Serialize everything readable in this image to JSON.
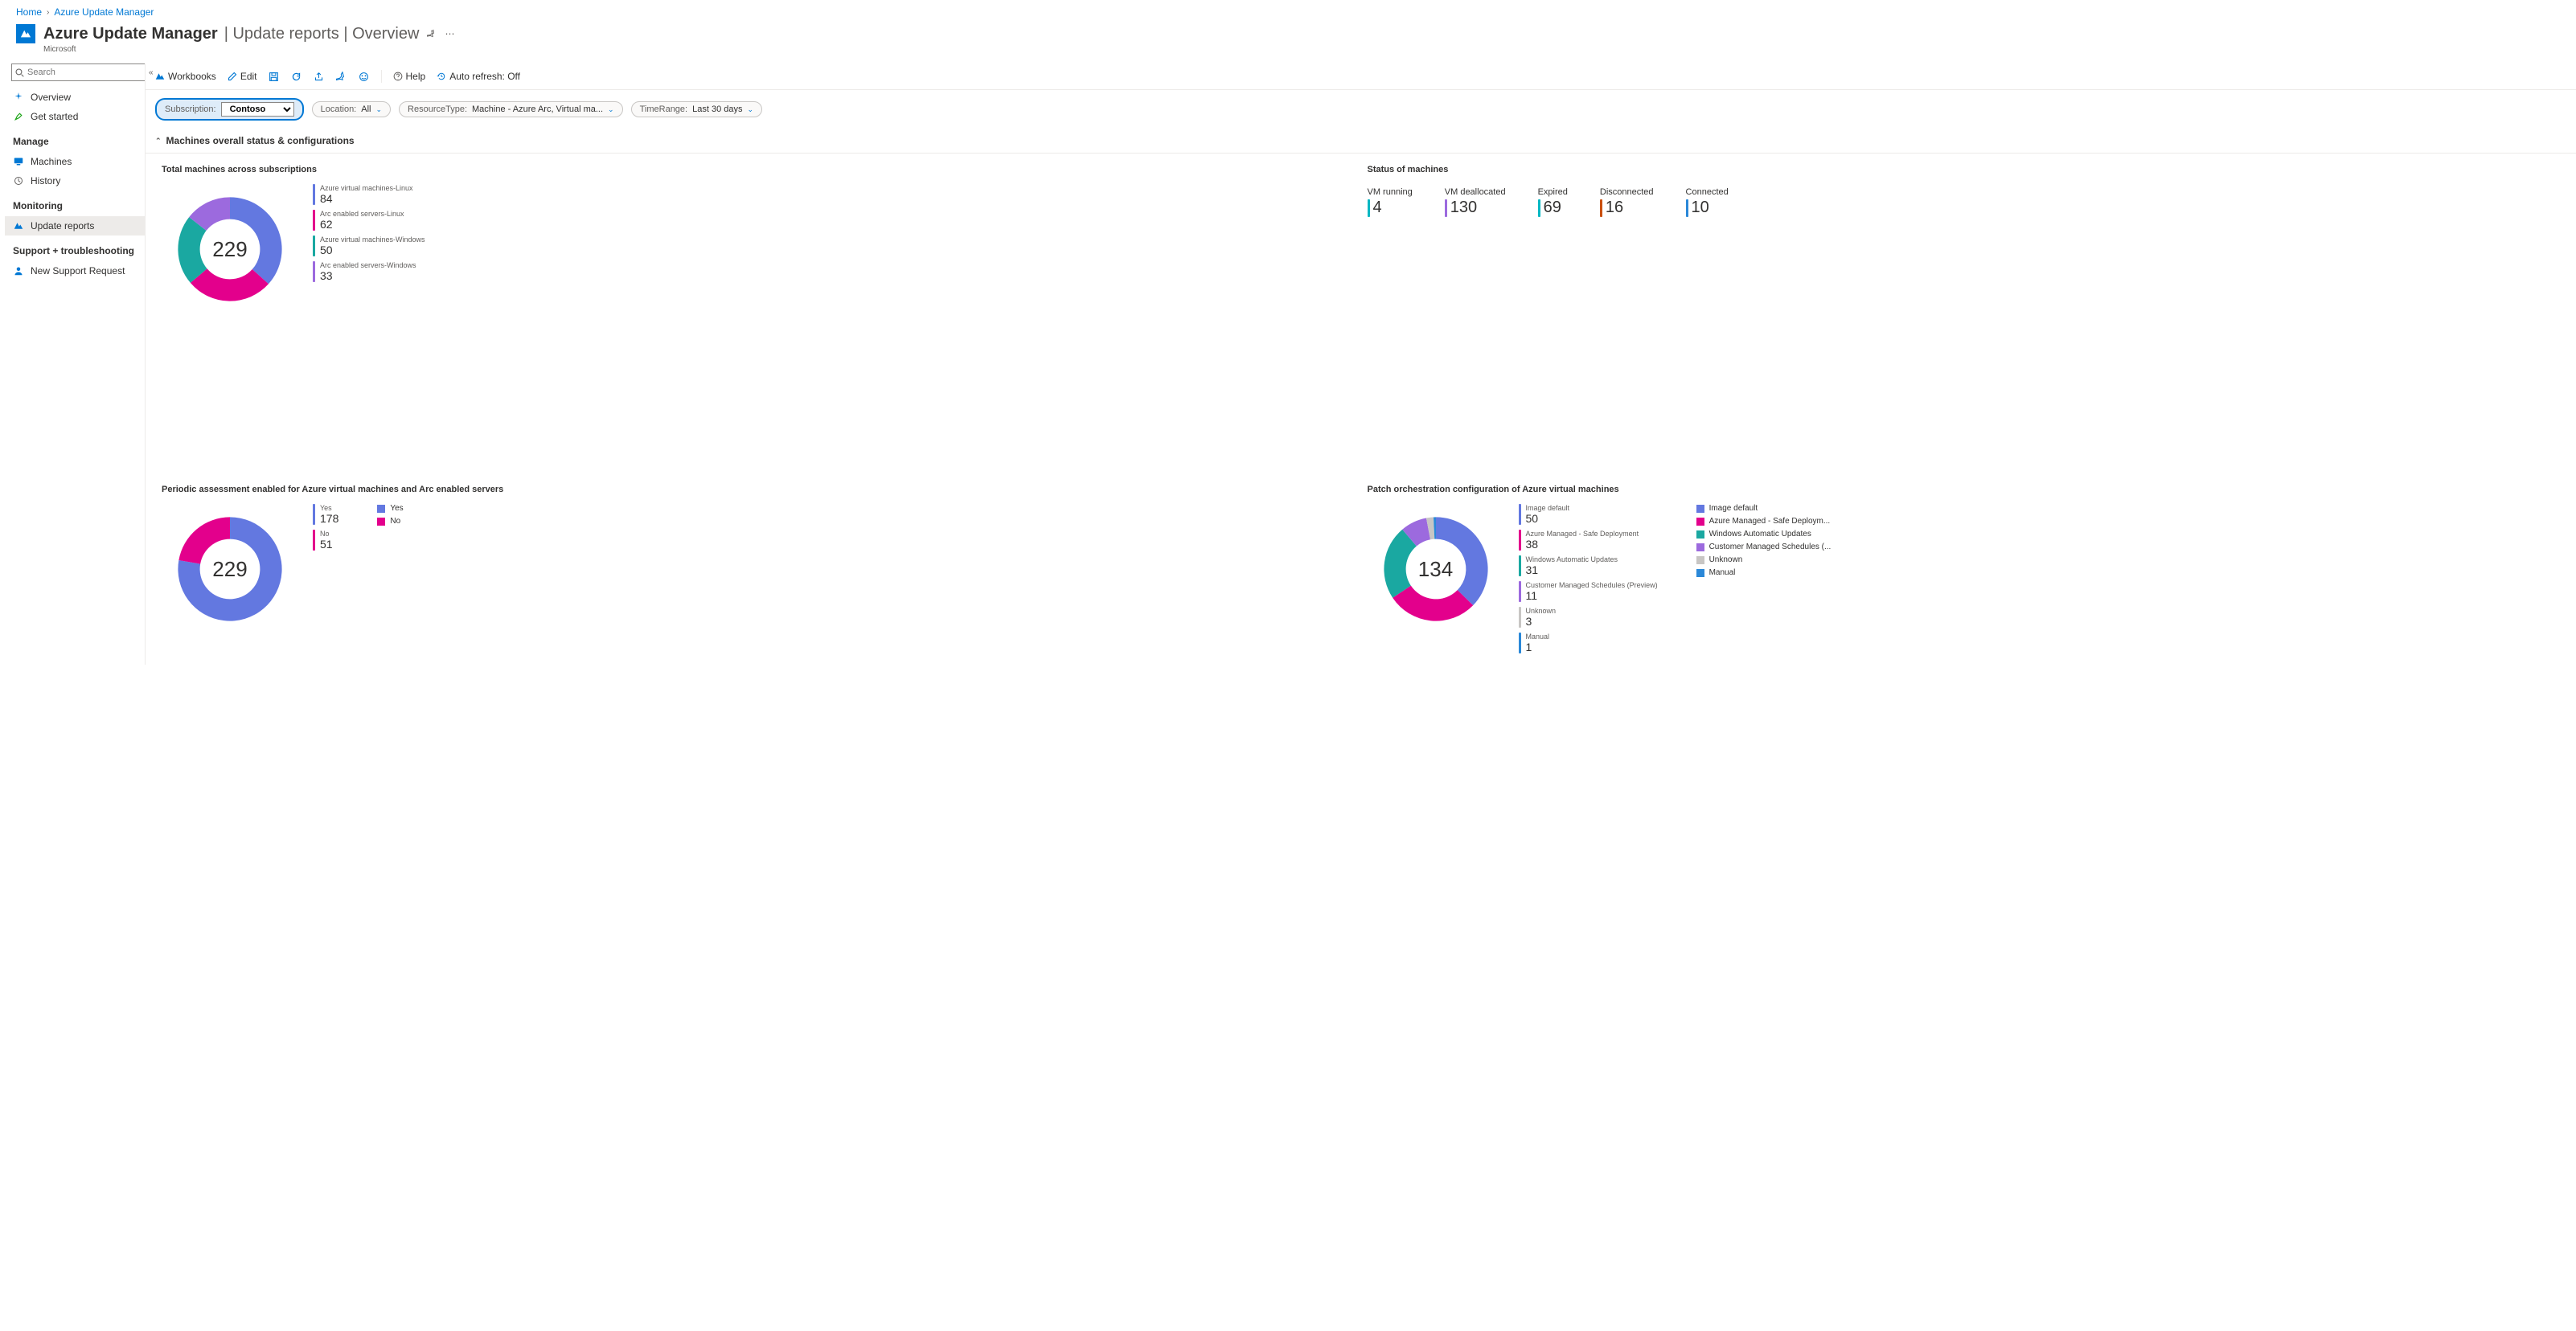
{
  "breadcrumb": {
    "home": "Home",
    "current": "Azure Update Manager"
  },
  "header": {
    "title": "Azure Update Manager",
    "subtitle": "| Update reports | Overview",
    "vendor": "Microsoft"
  },
  "search": {
    "placeholder": "Search"
  },
  "nav": {
    "items_top": [
      {
        "label": "Overview"
      },
      {
        "label": "Get started"
      }
    ],
    "manage_heading": "Manage",
    "items_manage": [
      {
        "label": "Machines"
      },
      {
        "label": "History"
      }
    ],
    "monitoring_heading": "Monitoring",
    "items_monitoring": [
      {
        "label": "Update reports"
      }
    ],
    "support_heading": "Support + troubleshooting",
    "items_support": [
      {
        "label": "New Support Request"
      }
    ]
  },
  "toolbar": {
    "workbooks": "Workbooks",
    "edit": "Edit",
    "help": "Help",
    "autorefresh": "Auto refresh: Off"
  },
  "filters": {
    "subscription_label": "Subscription:",
    "subscription_value": "Contoso",
    "location_label": "Location:",
    "location_value": "All",
    "resourcetype_label": "ResourceType:",
    "resourcetype_value": "Machine - Azure Arc, Virtual ma...",
    "timerange_label": "TimeRange:",
    "timerange_value": "Last 30 days"
  },
  "section_title": "Machines overall status & configurations",
  "cards": {
    "total_machines": {
      "title": "Total machines across subscriptions",
      "center": "229",
      "items": [
        {
          "label": "Azure virtual machines-Linux",
          "value": "84",
          "color": "c-blue"
        },
        {
          "label": "Arc enabled servers-Linux",
          "value": "62",
          "color": "c-magenta"
        },
        {
          "label": "Azure virtual machines-Windows",
          "value": "50",
          "color": "c-teal"
        },
        {
          "label": "Arc enabled servers-Windows",
          "value": "33",
          "color": "c-purple"
        }
      ]
    },
    "status": {
      "title": "Status of machines",
      "tiles": [
        {
          "label": "VM running",
          "value": "4",
          "color": "c-cyan"
        },
        {
          "label": "VM deallocated",
          "value": "130",
          "color": "c-purple"
        },
        {
          "label": "Expired",
          "value": "69",
          "color": "c-cyan"
        },
        {
          "label": "Disconnected",
          "value": "16",
          "color": "c-orange"
        },
        {
          "label": "Connected",
          "value": "10",
          "color": "c-dblue"
        }
      ]
    },
    "periodic": {
      "title": "Periodic assessment enabled for Azure virtual machines and Arc enabled servers",
      "center": "229",
      "items": [
        {
          "label": "Yes",
          "value": "178",
          "color": "c-blue"
        },
        {
          "label": "No",
          "value": "51",
          "color": "c-magenta"
        }
      ],
      "legend": [
        {
          "label": "Yes",
          "color": "c-blue"
        },
        {
          "label": "No",
          "color": "c-magenta"
        }
      ]
    },
    "patch": {
      "title": "Patch orchestration configuration of Azure virtual machines",
      "center": "134",
      "items": [
        {
          "label": "Image default",
          "value": "50",
          "color": "c-blue"
        },
        {
          "label": "Azure Managed - Safe Deployment",
          "value": "38",
          "color": "c-magenta"
        },
        {
          "label": "Windows Automatic Updates",
          "value": "31",
          "color": "c-teal"
        },
        {
          "label": "Customer Managed Schedules (Preview)",
          "value": "11",
          "color": "c-purple"
        },
        {
          "label": "Unknown",
          "value": "3",
          "color": "c-grey"
        },
        {
          "label": "Manual",
          "value": "1",
          "color": "c-dblue"
        }
      ],
      "legend": [
        {
          "label": "Image default",
          "color": "c-blue"
        },
        {
          "label": "Azure Managed - Safe Deploym...",
          "color": "c-magenta"
        },
        {
          "label": "Windows Automatic Updates",
          "color": "c-teal"
        },
        {
          "label": "Customer Managed Schedules (...",
          "color": "c-purple"
        },
        {
          "label": "Unknown",
          "color": "c-grey"
        },
        {
          "label": "Manual",
          "color": "c-dblue"
        }
      ]
    }
  },
  "chart_data": [
    {
      "type": "pie",
      "title": "Total machines across subscriptions",
      "categories": [
        "Azure virtual machines-Linux",
        "Arc enabled servers-Linux",
        "Azure virtual machines-Windows",
        "Arc enabled servers-Windows"
      ],
      "values": [
        84,
        62,
        50,
        33
      ],
      "total": 229
    },
    {
      "type": "table",
      "title": "Status of machines",
      "categories": [
        "VM running",
        "VM deallocated",
        "Expired",
        "Disconnected",
        "Connected"
      ],
      "values": [
        4,
        130,
        69,
        16,
        10
      ]
    },
    {
      "type": "pie",
      "title": "Periodic assessment enabled",
      "categories": [
        "Yes",
        "No"
      ],
      "values": [
        178,
        51
      ],
      "total": 229
    },
    {
      "type": "pie",
      "title": "Patch orchestration configuration",
      "categories": [
        "Image default",
        "Azure Managed - Safe Deployment",
        "Windows Automatic Updates",
        "Customer Managed Schedules (Preview)",
        "Unknown",
        "Manual"
      ],
      "values": [
        50,
        38,
        31,
        11,
        3,
        1
      ],
      "total": 134
    }
  ]
}
